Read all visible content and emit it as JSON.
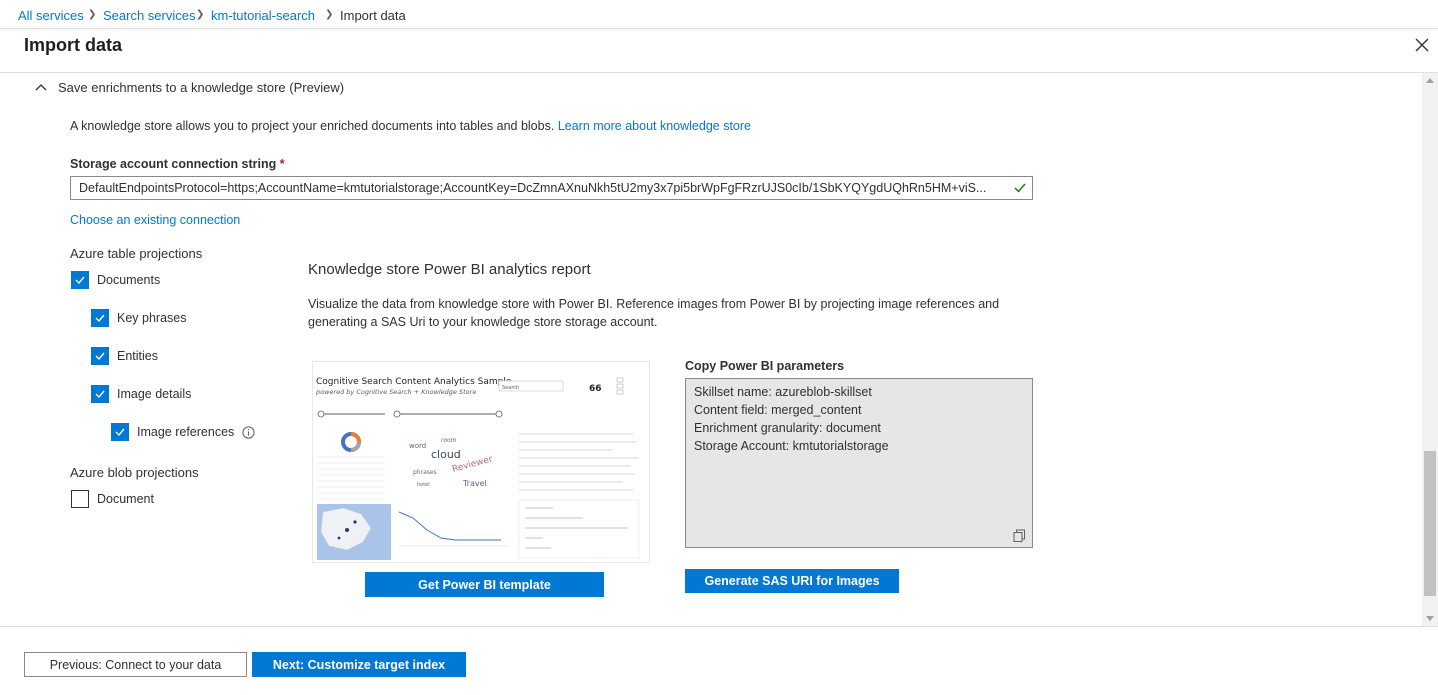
{
  "breadcrumb": {
    "items": [
      "All services",
      "Search services",
      "km-tutorial-search"
    ],
    "current": "Import data"
  },
  "page": {
    "title": "Import data"
  },
  "knowledge_store": {
    "section_title": "Save enrichments to a knowledge store (Preview)",
    "description": "A knowledge store allows you to project your enriched documents into tables and blobs.",
    "learn_more_link": "Learn more about knowledge store",
    "conn_label": "Storage account connection string",
    "required_mark": "*",
    "conn_value": "DefaultEndpointsProtocol=https;AccountName=kmtutorialstorage;AccountKey=DcZmnAXnuNkh5tU2my3x7pi5brWpFgFRzrUJS0cIb/1SbKYQYgdUQhRn5HM+viS...",
    "choose_connection_link": "Choose an existing connection"
  },
  "table_projections": {
    "title": "Azure table projections",
    "items": [
      {
        "label": "Documents",
        "checked": true
      },
      {
        "label": "Key phrases",
        "checked": true
      },
      {
        "label": "Entities",
        "checked": true
      },
      {
        "label": "Image details",
        "checked": true
      },
      {
        "label": "Image references",
        "checked": true
      }
    ]
  },
  "blob_projections": {
    "title": "Azure blob projections",
    "items": [
      {
        "label": "Document",
        "checked": false
      }
    ]
  },
  "powerbi": {
    "title": "Knowledge store Power BI analytics report",
    "description": "Visualize the data from knowledge store with Power BI. Reference images from Power BI by projecting image references and generating a SAS Uri to your knowledge store storage account.",
    "template_button": "Get Power BI template",
    "preview": {
      "title": "Cognitive Search Content Analytics Sample",
      "subtitle": "powered by Cognitive Search + Knowledge Store",
      "kpi_value": "66",
      "search_placeholder": "Search"
    },
    "params_label": "Copy Power BI parameters",
    "params": [
      "Skillset name: azureblob-skillset",
      "Content field: merged_content",
      "Enrichment granularity: document",
      "Storage Account: kmtutorialstorage"
    ],
    "sas_button": "Generate SAS URI for Images"
  },
  "footer": {
    "prev_button": "Previous: Connect to your data",
    "next_button": "Next: Customize target index"
  },
  "colors": {
    "accent": "#0078d4",
    "required": "#a4262c",
    "success": "#107c10"
  }
}
